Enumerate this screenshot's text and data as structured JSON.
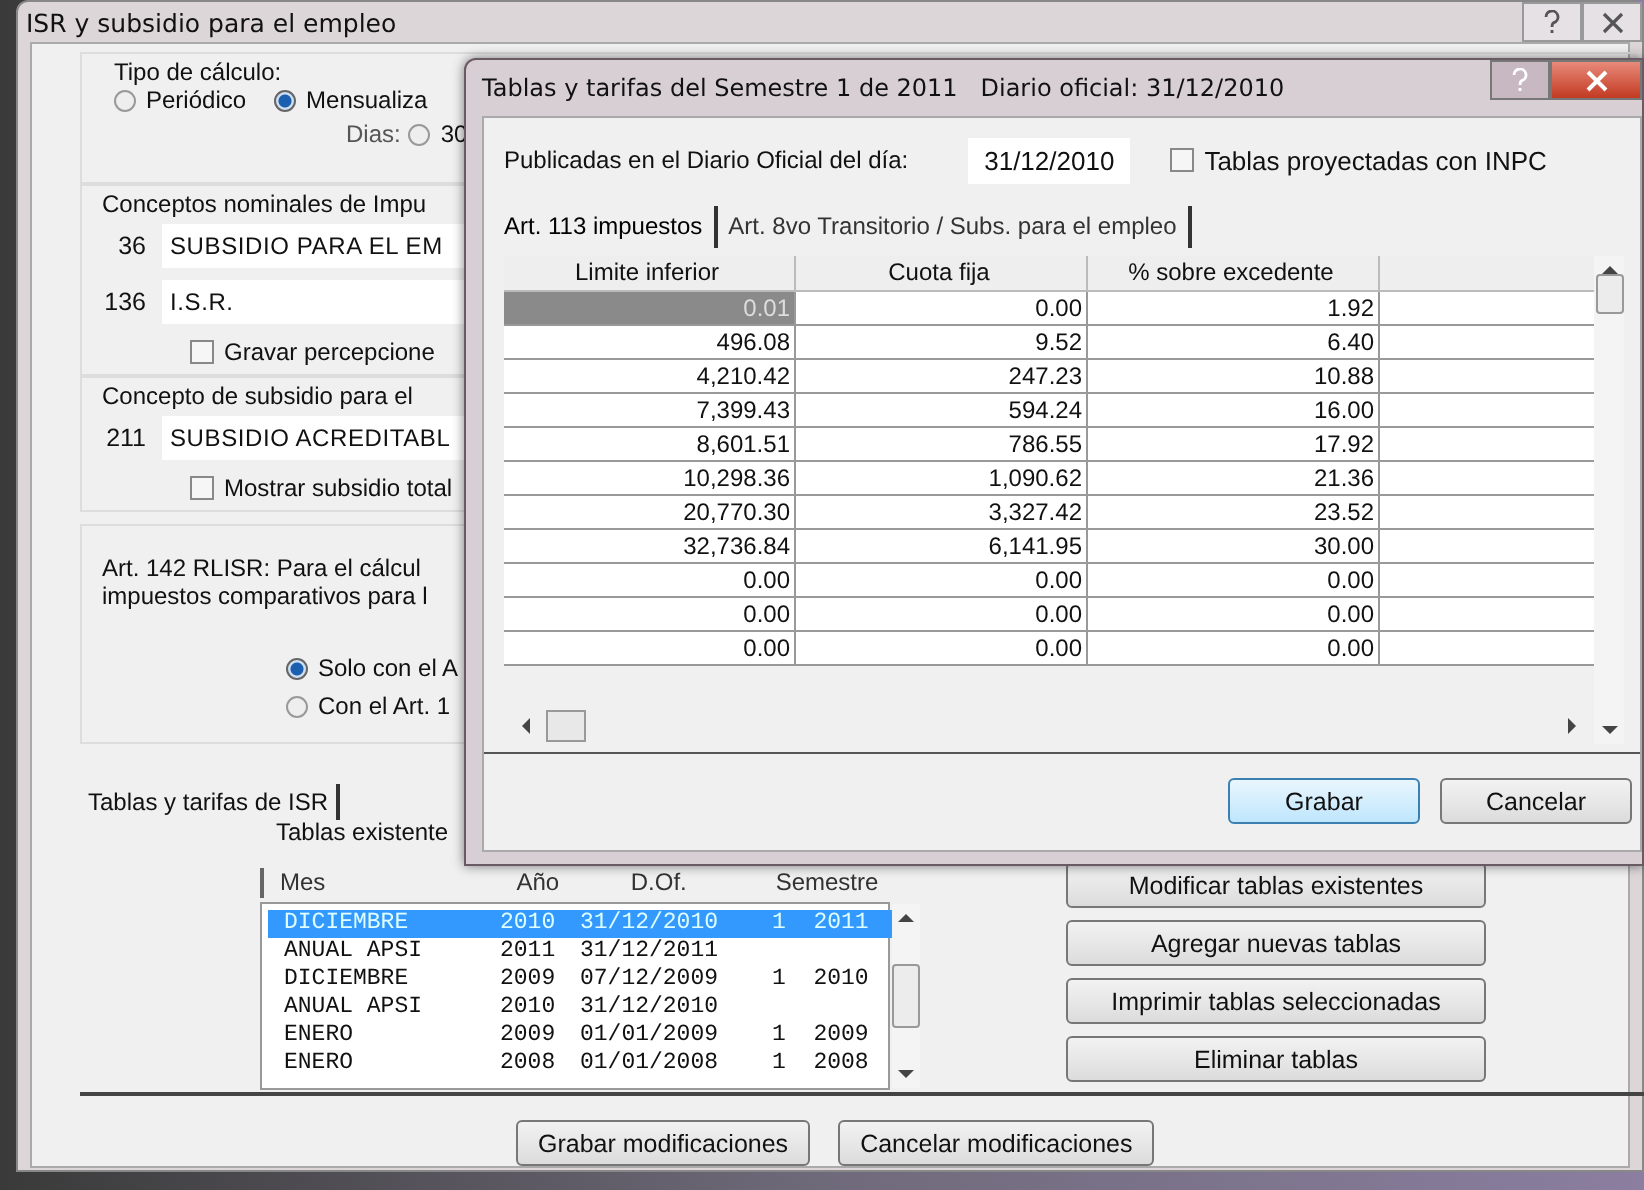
{
  "main_window": {
    "title": "ISR y subsidio para el empleo",
    "calc_type": {
      "label": "Tipo de cálculo:",
      "options": [
        {
          "label": "Periódico",
          "selected": false
        },
        {
          "label": "Mensualiza",
          "selected": true
        }
      ],
      "days_label": "Dias:",
      "days_options": [
        {
          "label": "30",
          "selected": false
        }
      ]
    },
    "concepts": {
      "label": "Conceptos nominales de Impu",
      "items": [
        {
          "code": "36",
          "name": "SUBSIDIO PARA EL EM"
        },
        {
          "code": "136",
          "name": "I.S.R."
        }
      ],
      "checkbox": {
        "label": "Gravar percepcione",
        "checked": false
      }
    },
    "subsidy": {
      "label": "Concepto de subsidio para el",
      "code": "211",
      "name": "SUBSIDIO ACREDITABL",
      "checkbox": {
        "label": "Mostrar subsidio total",
        "checked": false
      }
    },
    "art142": {
      "lines": [
        "Art. 142 RLISR: Para el cálcul",
        "impuestos comparativos para l"
      ],
      "options": [
        {
          "label": "Solo con el A",
          "selected": true
        },
        {
          "label": "Con el Art. 1",
          "selected": false
        }
      ]
    },
    "tables_tab": {
      "label": "Tablas y tarifas de ISR",
      "existing_label": "Tablas existente",
      "columns": [
        "Mes",
        "Año",
        "D.Of.",
        "Semestre"
      ],
      "rows": [
        {
          "cells": [
            "DICIEMBRE",
            "2010",
            "31/12/2010",
            "1  2011"
          ],
          "selected": true
        },
        {
          "cells": [
            "ANUAL APSI",
            "2011",
            "31/12/2011"
          ],
          "selected": false
        },
        {
          "cells": [
            "DICIEMBRE",
            "2009",
            "07/12/2009",
            "1  2010"
          ],
          "selected": false
        },
        {
          "cells": [
            "ANUAL APSI",
            "2010",
            "31/12/2010"
          ],
          "selected": false
        },
        {
          "cells": [
            "ENERO",
            "2009",
            "01/01/2009",
            "1  2009"
          ],
          "selected": false
        },
        {
          "cells": [
            "ENERO",
            "2008",
            "01/01/2008",
            "1  2008"
          ],
          "selected": false
        }
      ],
      "buttons": [
        "Modificar tablas existentes",
        "Agregar nuevas tablas",
        "Imprimir tablas seleccionadas",
        "Eliminar tablas"
      ]
    },
    "buttons": [
      "Grabar modificaciones",
      "Cancelar modificaciones"
    ]
  },
  "dialog": {
    "title": "Tablas y tarifas del Semestre 1 de 2011   Diario oficial: 31/12/2010",
    "published_label": "Publicadas en el Diario Oficial del día:",
    "published_date": "31/12/2010",
    "projected": {
      "label": "Tablas proyectadas con INPC",
      "checked": false
    },
    "tabs": [
      {
        "label": "Art. 113 impuestos",
        "selected": true
      },
      {
        "label": "Art. 8vo Transitorio / Subs. para el empleo",
        "selected": false
      }
    ],
    "table": {
      "columns": [
        "Limite inferior",
        "Cuota fija",
        "% sobre excedente"
      ],
      "rows": [
        {
          "cells": [
            "0.01",
            "0.00",
            "1.92"
          ],
          "selected": true
        },
        {
          "cells": [
            "496.08",
            "9.52",
            "6.40"
          ],
          "selected": false
        },
        {
          "cells": [
            "4,210.42",
            "247.23",
            "10.88"
          ],
          "selected": false
        },
        {
          "cells": [
            "7,399.43",
            "594.24",
            "16.00"
          ],
          "selected": false
        },
        {
          "cells": [
            "8,601.51",
            "786.55",
            "17.92"
          ],
          "selected": false
        },
        {
          "cells": [
            "10,298.36",
            "1,090.62",
            "21.36"
          ],
          "selected": false
        },
        {
          "cells": [
            "20,770.30",
            "3,327.42",
            "23.52"
          ],
          "selected": false
        },
        {
          "cells": [
            "32,736.84",
            "6,141.95",
            "30.00"
          ],
          "selected": false
        },
        {
          "cells": [
            "0.00",
            "0.00",
            "0.00"
          ],
          "selected": false
        },
        {
          "cells": [
            "0.00",
            "0.00",
            "0.00"
          ],
          "selected": false
        },
        {
          "cells": [
            "0.00",
            "0.00",
            "0.00"
          ],
          "selected": false
        }
      ]
    },
    "buttons": [
      "Grabar",
      "Cancelar"
    ]
  }
}
